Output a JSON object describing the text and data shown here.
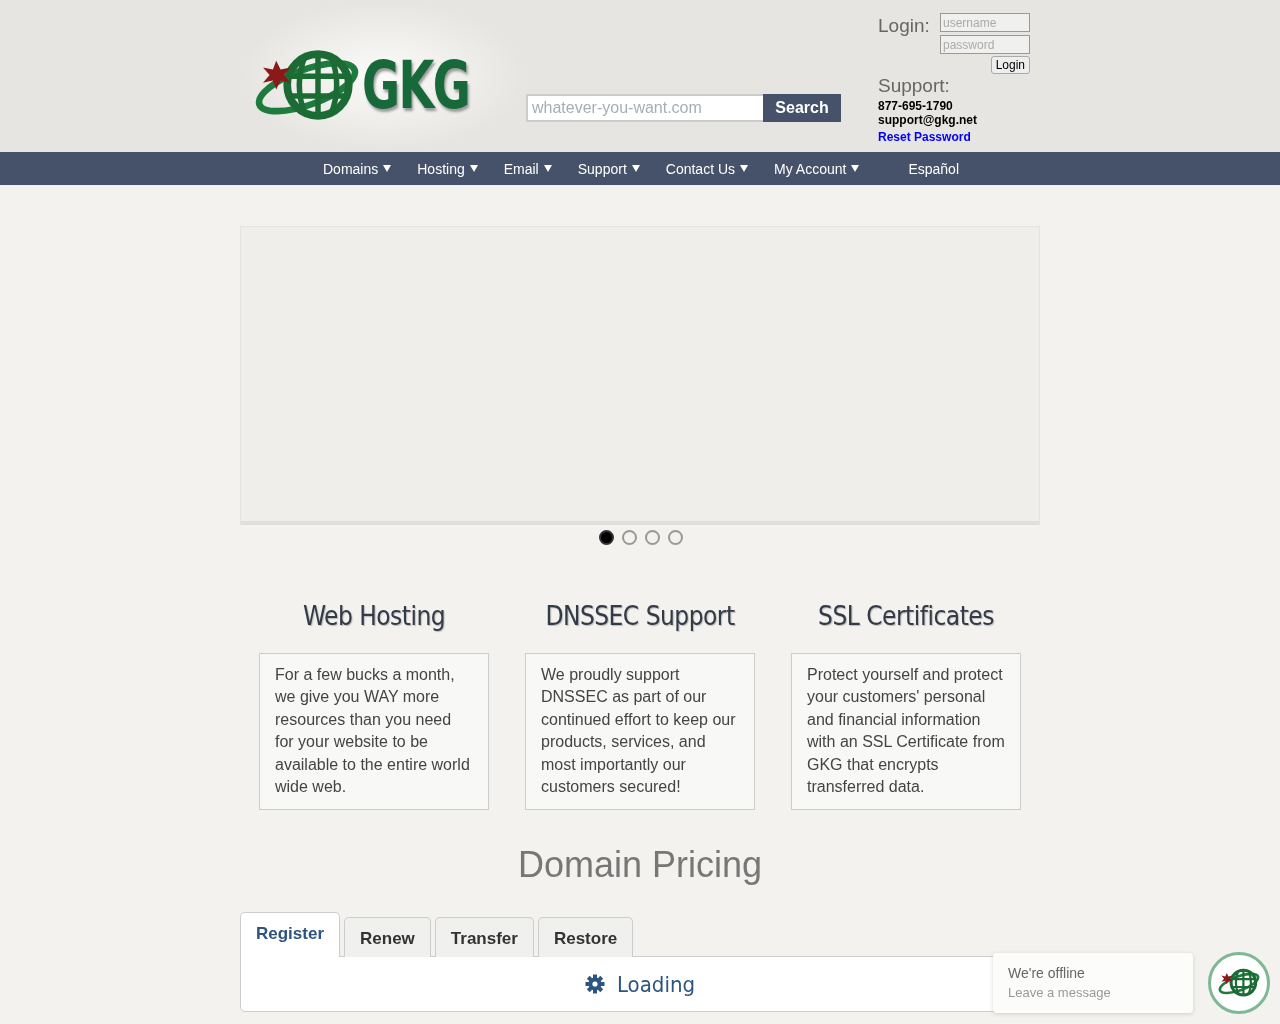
{
  "header": {
    "logo_text": "GKG",
    "search": {
      "placeholder": "whatever-you-want.com",
      "button": "Search"
    },
    "login": {
      "label": "Login:",
      "username_placeholder": "username",
      "password_placeholder": "password",
      "button": "Login"
    },
    "support": {
      "label": "Support:",
      "phone": "877-695-1790",
      "email": "support@gkg.net",
      "reset_link": "Reset Password"
    }
  },
  "nav": [
    {
      "label": "Domains",
      "dropdown": true
    },
    {
      "label": "Hosting",
      "dropdown": true
    },
    {
      "label": "Email",
      "dropdown": true
    },
    {
      "label": "Support",
      "dropdown": true
    },
    {
      "label": "Contact Us",
      "dropdown": true
    },
    {
      "label": "My Account",
      "dropdown": true
    },
    {
      "label": "Español",
      "dropdown": false
    }
  ],
  "slider": {
    "dots": [
      {
        "selected": true
      },
      {
        "selected": false
      },
      {
        "selected": false
      },
      {
        "selected": false
      }
    ]
  },
  "features": [
    {
      "title": "Web Hosting",
      "text": "For a few bucks a month, we give you WAY more resources than you need for your website to be available to the entire world wide web."
    },
    {
      "title": "DNSSEC Support",
      "text": "We proudly support DNSSEC as part of our continued effort to keep our products, services, and most importantly our customers secured!"
    },
    {
      "title": "SSL Certificates",
      "text": "Protect yourself and protect your customers' personal and financial information with an SSL Certificate from GKG that encrypts transferred data."
    }
  ],
  "pricing": {
    "title": "Domain Pricing",
    "tabs": [
      {
        "label": "Register",
        "selected": true
      },
      {
        "label": "Renew",
        "selected": false
      },
      {
        "label": "Transfer",
        "selected": false
      },
      {
        "label": "Restore",
        "selected": false
      }
    ],
    "status": "Loading"
  },
  "chat": {
    "title": "We're offline",
    "subtitle": "Leave a message"
  }
}
